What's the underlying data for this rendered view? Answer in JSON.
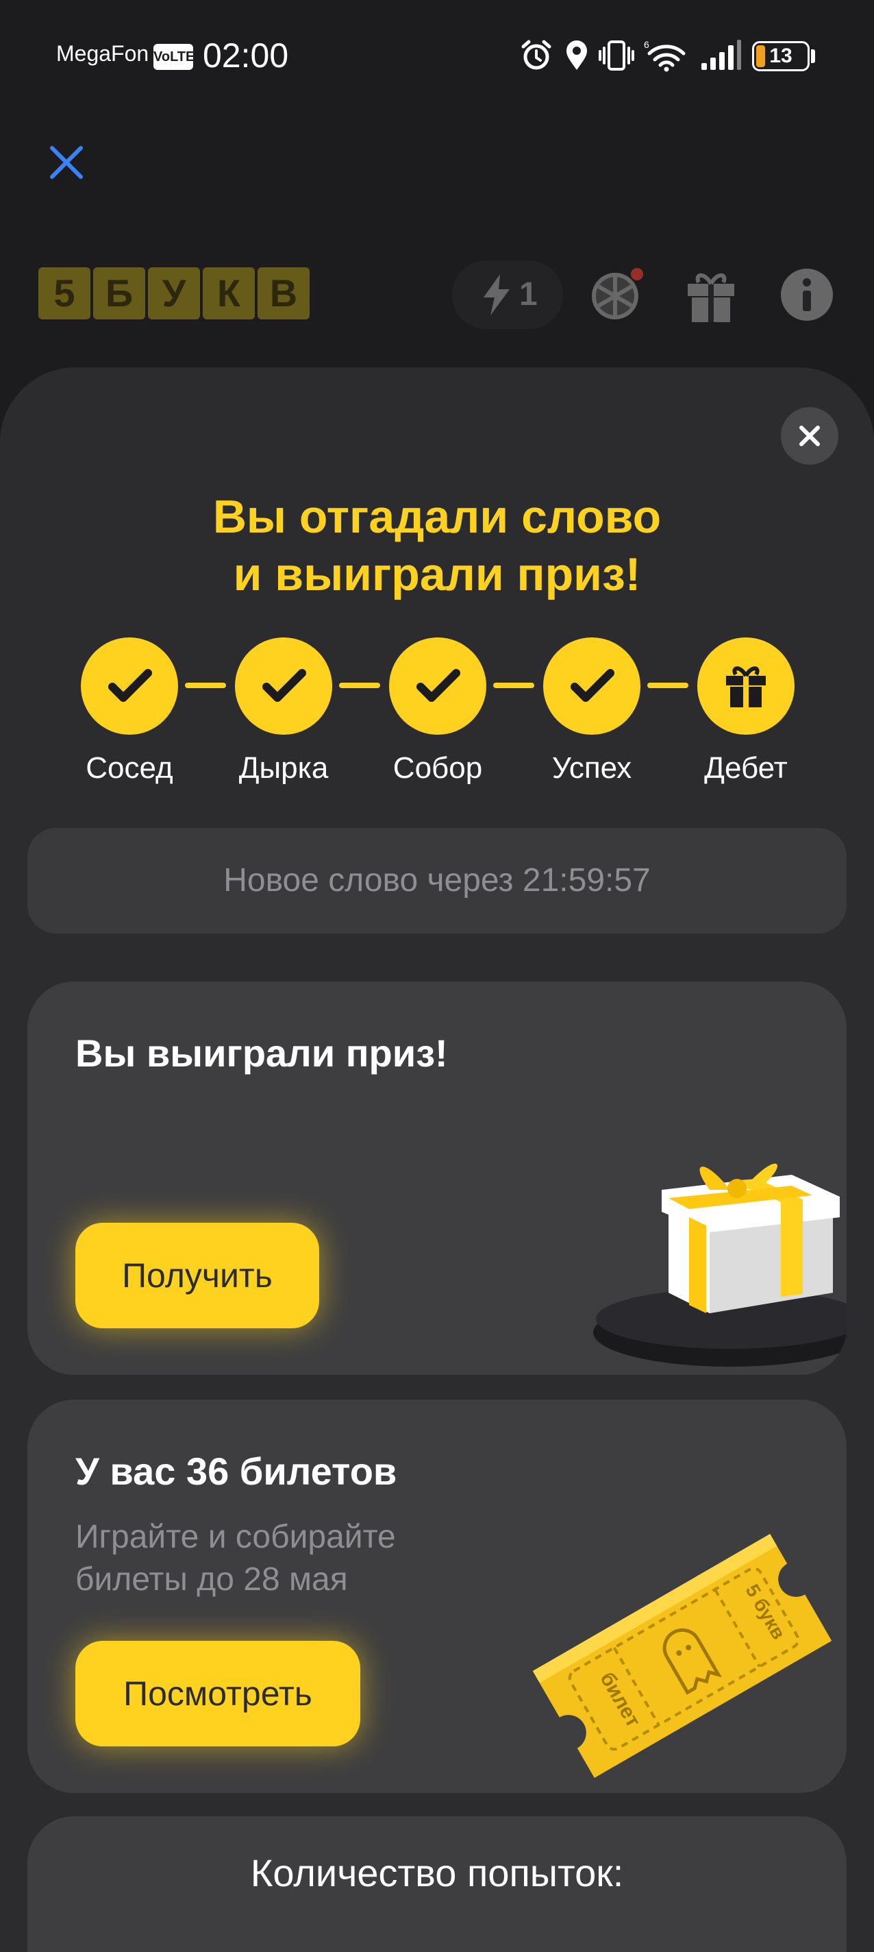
{
  "status_bar": {
    "carrier": "MegaFon",
    "volte": "VoLTE",
    "time": "02:00",
    "battery": "13",
    "icons": [
      "alarm-icon",
      "location-icon",
      "vibrate-icon",
      "wifi-icon",
      "signal-icon",
      "battery-icon"
    ]
  },
  "header": {
    "logo_letters": [
      "5",
      "Б",
      "У",
      "К",
      "В"
    ],
    "energy_count": "1",
    "icons": [
      "close-icon",
      "lightning-icon",
      "wheel-icon",
      "gift-icon",
      "info-icon"
    ]
  },
  "sheet": {
    "title_line1": "Вы отгадали слово",
    "title_line2": "и выиграли приз!",
    "steps": [
      {
        "label": "Сосед",
        "state": "done"
      },
      {
        "label": "Дырка",
        "state": "done"
      },
      {
        "label": "Собор",
        "state": "done"
      },
      {
        "label": "Успех",
        "state": "done"
      },
      {
        "label": "Дебет",
        "state": "gift"
      }
    ],
    "timer_text": "Новое слово через 21:59:57"
  },
  "prize_card": {
    "title": "Вы выиграли приз!",
    "button_label": "Получить"
  },
  "tickets_card": {
    "title": "У вас 36 билетов",
    "subtitle_line1": "Играйте и собирайте",
    "subtitle_line2": "билеты до 28 мая",
    "button_label": "Посмотреть",
    "ticket_word_left": "билет",
    "ticket_word_right": "5 букв"
  },
  "attempts_card": {
    "title": "Количество попыток:"
  },
  "colors": {
    "accent": "#ffd21f",
    "background": "#1c1c1e",
    "sheet": "#2c2c2e",
    "card": "#3e3e40",
    "close_blue": "#3a82f7"
  }
}
